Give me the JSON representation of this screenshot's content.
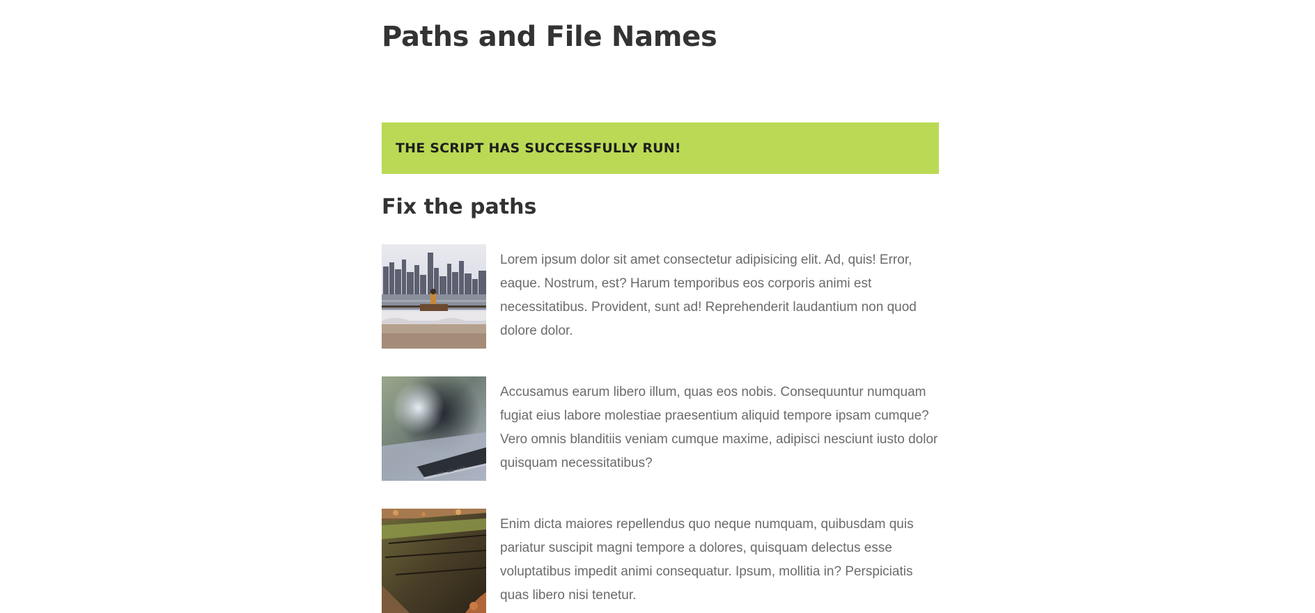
{
  "page": {
    "title": "Paths and File Names",
    "success_message": "THE SCRIPT HAS SUCCESSFULLY RUN!",
    "section_title": "Fix the paths"
  },
  "colors": {
    "banner": "#bada55",
    "heading": "#333333",
    "body_text": "#6b6b6b"
  },
  "items": [
    {
      "image": "city-skyline-bench-photo",
      "text": "Lorem ipsum dolor sit amet consectetur adipisicing elit. Ad, quis! Error, eaque. Nostrum, est? Harum temporibus eos corporis animi est necessitatibus. Provident, sunt ad! Reprehenderit laudantium non quod dolore dolor."
    },
    {
      "image": "smartphone-closeup-photo",
      "text": "Accusamus earum libero illum, quas eos nobis. Consequuntur numquam fugiat eius labore molestiae praesentium aliquid tempore ipsam cumque? Vero omnis blanditiis veniam cumque maxime, adipisci nesciunt iusto dolor quisquam necessitatibus?"
    },
    {
      "image": "mossy-log-photo",
      "text": "Enim dicta maiores repellendus quo neque numquam, quibusdam quis pariatur suscipit magni tempore a dolores, quisquam delectus esse voluptatibus impedit animi consequatur. Ipsum, mollitia in? Perspiciatis quas libero nisi tenetur."
    }
  ]
}
